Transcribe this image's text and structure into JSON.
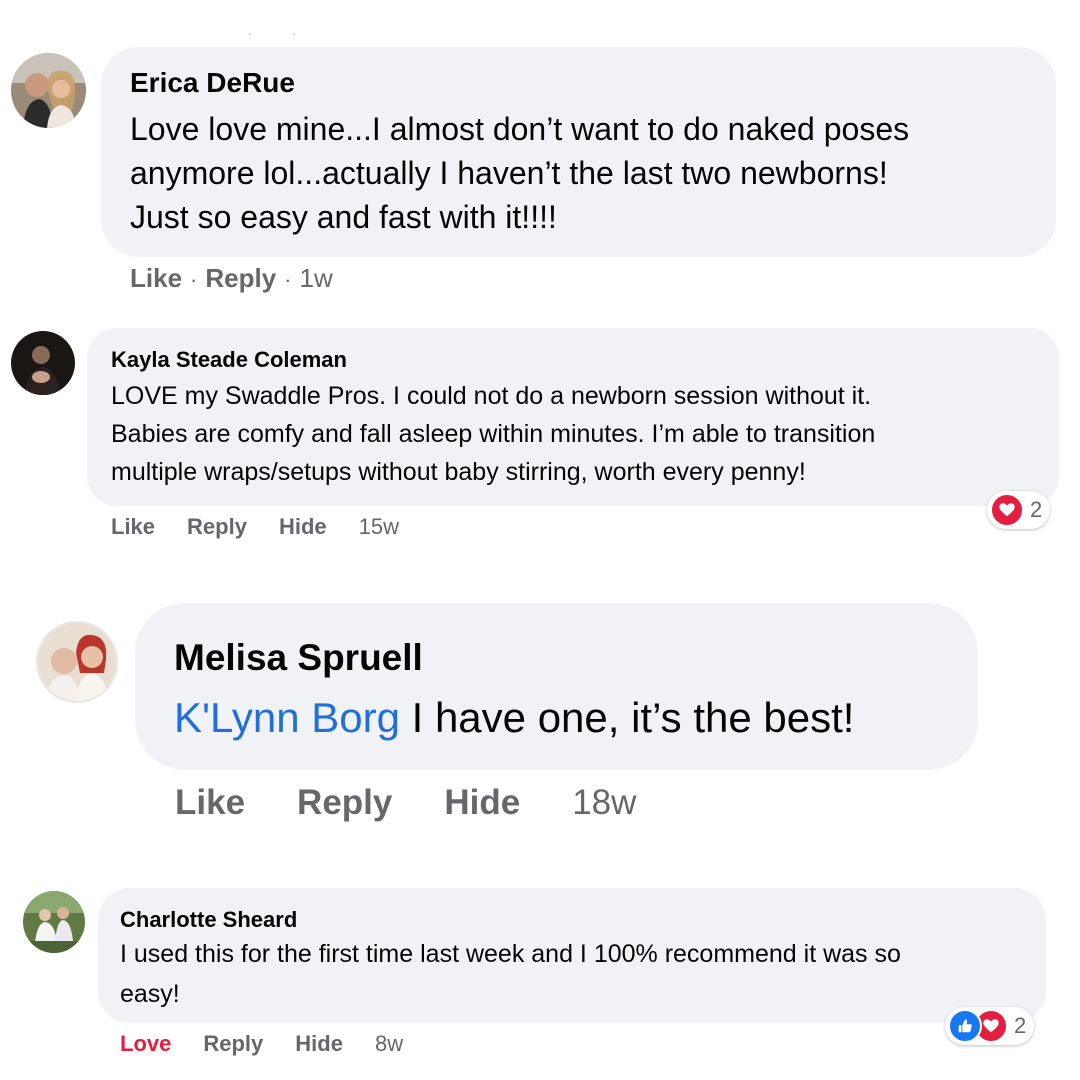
{
  "comments": [
    {
      "author": "Erica DeRue",
      "text_lines": [
        "Love love mine...I almost don’t want to do naked poses",
        "anymore lol...actually I haven’t the last two newborns!",
        "Just so easy and fast with it!!!!"
      ],
      "actions": {
        "like": "Like",
        "sep1": "·",
        "reply": "Reply",
        "sep2": "·",
        "time": "1w"
      }
    },
    {
      "author": "Kayla Steade Coleman",
      "text_lines": [
        "LOVE my Swaddle Pros. I could not do a newborn session without it.",
        "Babies are comfy and fall asleep within minutes. I’m able to transition",
        "multiple wraps/setups without baby stirring, worth every penny!"
      ],
      "actions": {
        "like": "Like",
        "reply": "Reply",
        "hide": "Hide",
        "time": "15w"
      },
      "reactions": {
        "icons": [
          "love-icon"
        ],
        "count": "2"
      }
    },
    {
      "author": "Melisa Spruell",
      "mention": "K'Lynn Borg",
      "text": " I have one, it’s the best!",
      "actions": {
        "like": "Like",
        "reply": "Reply",
        "hide": "Hide",
        "time": "18w"
      }
    },
    {
      "author": "Charlotte Sheard",
      "text_lines": [
        "I used this for the first time last week and I 100% recommend it was so",
        "easy!"
      ],
      "actions": {
        "love": "Love",
        "reply": "Reply",
        "hide": "Hide",
        "time": "8w"
      },
      "reactions": {
        "icons": [
          "like-icon",
          "love-icon"
        ],
        "count": "2"
      }
    }
  ],
  "colors": {
    "bubble": "#f0f2f5",
    "meta_gray": "#65676b",
    "mention_blue": "#216fdb",
    "love_red": "#e41e3f",
    "like_blue": "#1877f2"
  }
}
